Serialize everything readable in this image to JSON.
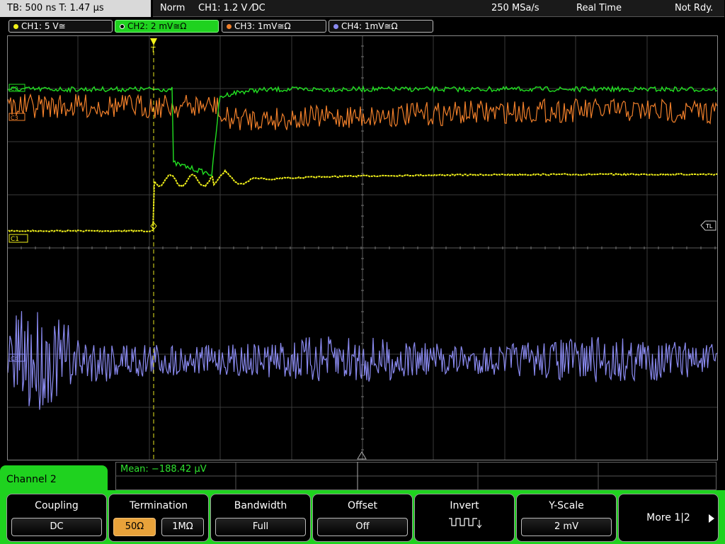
{
  "status": {
    "timebase": "TB: 500 ns   T: 1.47 µs",
    "mode": "Norm",
    "trigger": "CH1: 1.2 V ⁄DC",
    "sample_rate": "250 MSa/s",
    "acq_mode": "Real Time",
    "readiness": "Not Rdy."
  },
  "channels": [
    {
      "label": "CH1: 5 V≅",
      "color": "#f2f21a"
    },
    {
      "label": "CH2: 2 mV≅Ω",
      "color": "#22e022"
    },
    {
      "label": "CH3: 1mV≅Ω",
      "color": "#f07f2a"
    },
    {
      "label": "CH4: 1mV≅Ω",
      "color": "#8a8af0"
    }
  ],
  "markers": {
    "c2": "C2",
    "c3": "C3",
    "c1": "C1",
    "c4": "C4",
    "trigger_level": "TL",
    "trigger_pos": "T"
  },
  "measurement": "Mean: −188.42 µV",
  "menu": {
    "channel": "Channel 2",
    "coupling": {
      "title": "Coupling",
      "value": "DC"
    },
    "termination": {
      "title": "Termination",
      "opt1": "50Ω",
      "opt2": "1MΩ"
    },
    "bandwidth": {
      "title": "Bandwidth",
      "value": "Full"
    },
    "offset": {
      "title": "Offset",
      "value": "Off"
    },
    "invert": {
      "title": "Invert"
    },
    "yscale": {
      "title": "Y-Scale",
      "value": "2 mV"
    },
    "more": "More 1|2"
  }
}
